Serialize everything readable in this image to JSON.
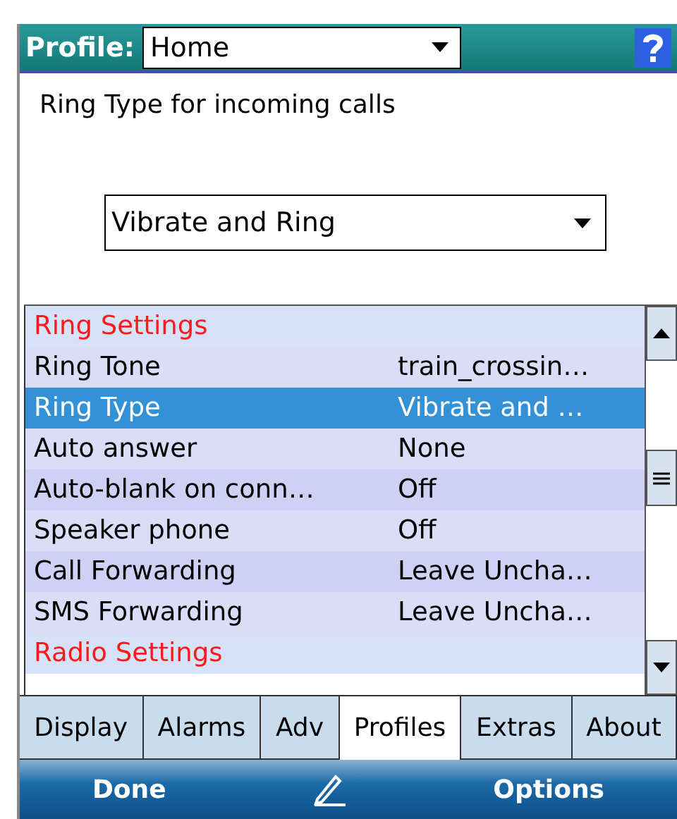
{
  "header": {
    "label": "Profile:",
    "profile": "Home"
  },
  "description": "Ring Type for incoming calls",
  "ring_type": {
    "value": "Vibrate and Ring"
  },
  "settings": [
    {
      "kind": "header",
      "label": "Ring Settings"
    },
    {
      "kind": "item",
      "label": "Ring Tone",
      "value": "train_crossin…",
      "selected": false
    },
    {
      "kind": "item",
      "label": "Ring Type",
      "value": "Vibrate and …",
      "selected": true
    },
    {
      "kind": "item",
      "label": "Auto answer",
      "value": "None",
      "selected": false
    },
    {
      "kind": "item",
      "label": "Auto-blank on conn…",
      "value": "Off",
      "selected": false
    },
    {
      "kind": "item",
      "label": "Speaker phone",
      "value": "Off",
      "selected": false
    },
    {
      "kind": "item",
      "label": "Call Forwarding",
      "value": "Leave Uncha…",
      "selected": false
    },
    {
      "kind": "item",
      "label": "SMS Forwarding",
      "value": "Leave Uncha…",
      "selected": false
    },
    {
      "kind": "header",
      "label": "Radio Settings"
    }
  ],
  "tabs": [
    {
      "label": "Display",
      "selected": false
    },
    {
      "label": "Alarms",
      "selected": false
    },
    {
      "label": "Adv",
      "selected": false
    },
    {
      "label": "Profiles",
      "selected": true
    },
    {
      "label": "Extras",
      "selected": false
    },
    {
      "label": "About",
      "selected": false
    }
  ],
  "softkeys": {
    "left": "Done",
    "right": "Options"
  }
}
